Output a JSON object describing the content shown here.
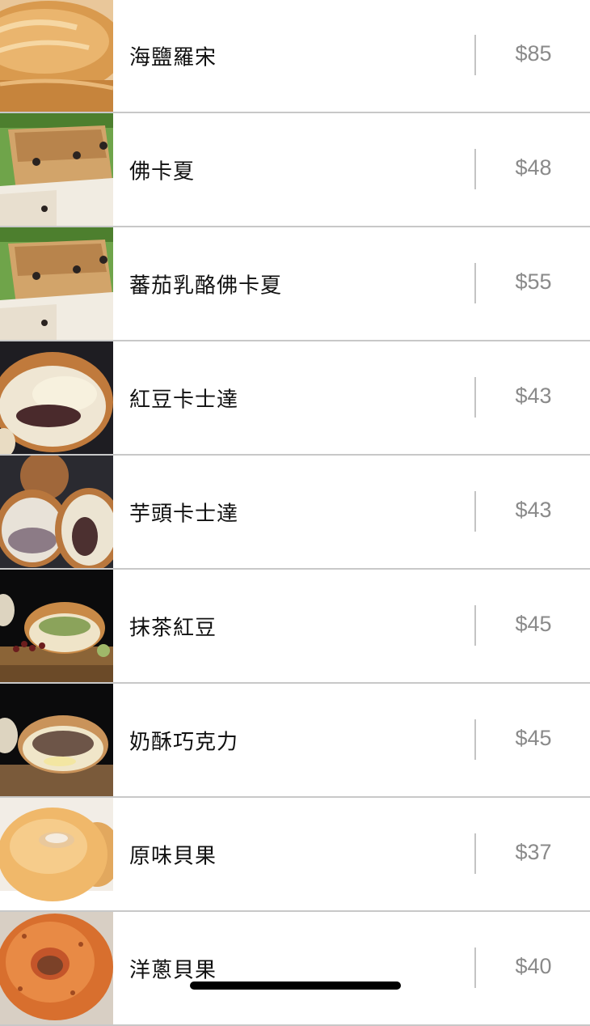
{
  "menu": {
    "items": [
      {
        "name": "海鹽羅宋",
        "price": "$85",
        "image": "salt-roll-bread-photo"
      },
      {
        "name": "佛卡夏",
        "price": "$48",
        "image": "focaccia-photo"
      },
      {
        "name": "蕃茄乳酪佛卡夏",
        "price": "$55",
        "image": "tomato-cheese-focaccia-photo"
      },
      {
        "name": "紅豆卡士達",
        "price": "$43",
        "image": "red-bean-custard-bun-photo"
      },
      {
        "name": "芋頭卡士達",
        "price": "$43",
        "image": "taro-custard-bun-photo"
      },
      {
        "name": "抹茶紅豆",
        "price": "$45",
        "image": "matcha-red-bean-bun-photo"
      },
      {
        "name": "奶酥巧克力",
        "price": "$45",
        "image": "milk-crumble-chocolate-bun-photo"
      },
      {
        "name": "原味貝果",
        "price": "$37",
        "image": "plain-bagel-photo"
      },
      {
        "name": "洋蔥貝果",
        "price": "$40",
        "image": "onion-bagel-photo"
      }
    ]
  },
  "colors": {
    "name_text": "#111111",
    "price_text": "#8a8a8a",
    "row_separator": "#c8c8c8",
    "background": "#ffffff"
  }
}
